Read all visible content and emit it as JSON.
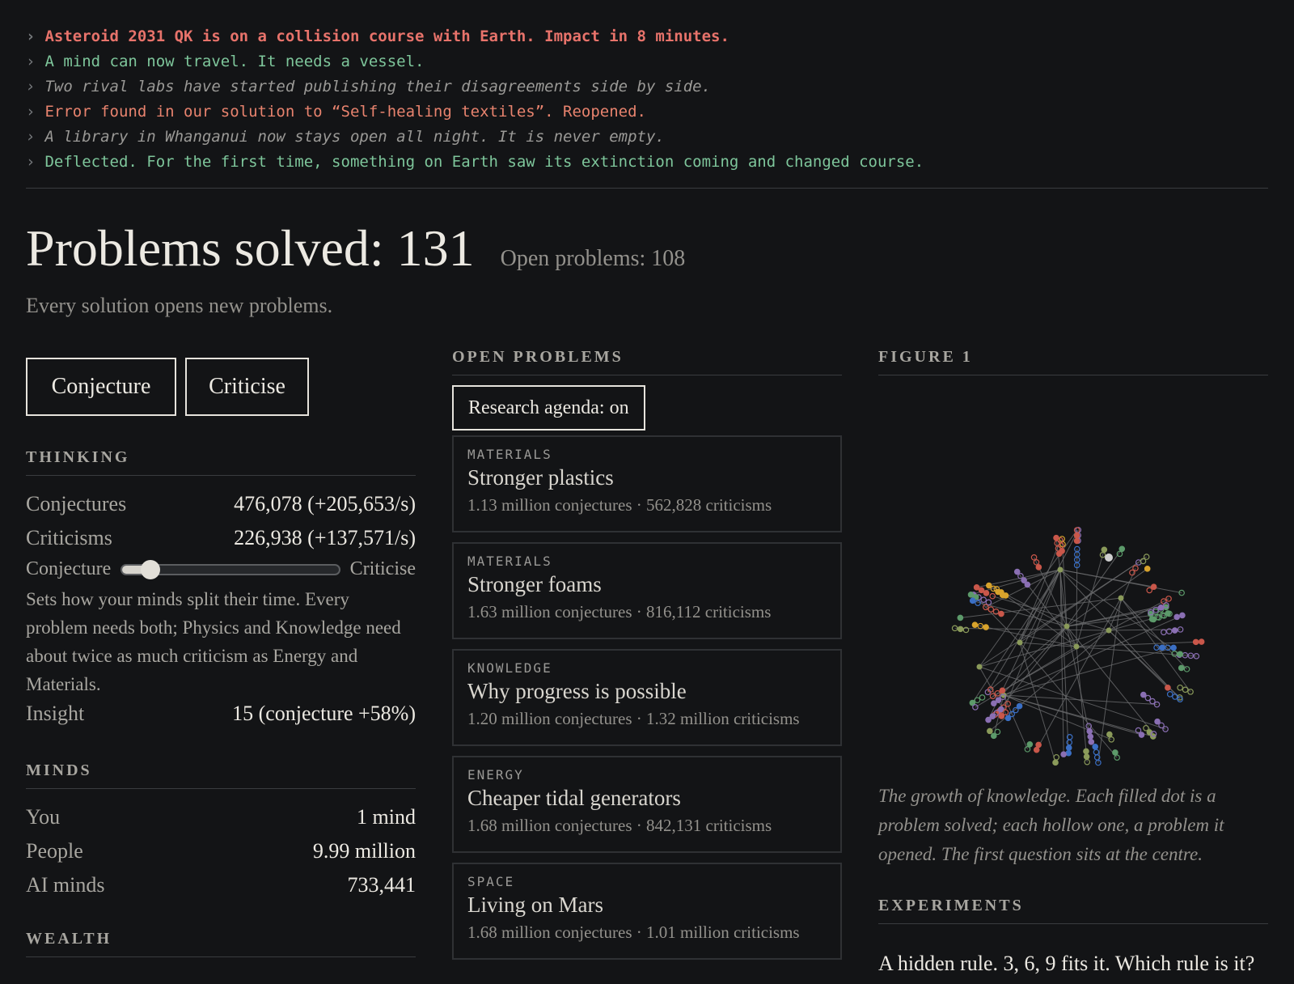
{
  "log": [
    {
      "text": "Asteroid 2031 QK is on a collision course with Earth. Impact in 8 minutes.",
      "kind": "alert"
    },
    {
      "text": "A mind can now travel. It needs a vessel.",
      "kind": "good"
    },
    {
      "text": "Two rival labs have started publishing their disagreements side by side.",
      "kind": "muted"
    },
    {
      "text": "Error found in our solution to “Self-healing textiles”. Reopened.",
      "kind": "error"
    },
    {
      "text": "A library in Whanganui now stays open all night. It is never empty.",
      "kind": "muted"
    },
    {
      "text": "Deflected. For the first time, something on Earth saw its extinction coming and changed course.",
      "kind": "good"
    }
  ],
  "log_chevron": "›",
  "header": {
    "solved": "Problems solved: 131",
    "open": "Open problems: 108",
    "tagline": "Every solution opens new problems."
  },
  "actions": {
    "conjecture": "Conjecture",
    "criticise": "Criticise"
  },
  "thinking": {
    "title": "THINKING",
    "conjectures_label": "Conjectures",
    "conjectures_value": "476,078 (+205,653/s)",
    "criticisms_label": "Criticisms",
    "criticisms_value": "226,938 (+137,571/s)",
    "slider_left": "Conjecture",
    "slider_right": "Criticise",
    "slider_value": 0.12,
    "description": "Sets how your minds split their time. Every problem needs both; Physics and Knowledge need about twice as much criticism as Energy and Materials.",
    "insight_label": "Insight",
    "insight_value": "15 (conjecture +58%)"
  },
  "minds": {
    "title": "MINDS",
    "rows": [
      {
        "label": "You",
        "value": "1 mind"
      },
      {
        "label": "People",
        "value": "9.99 million"
      },
      {
        "label": "AI minds",
        "value": "733,441"
      }
    ]
  },
  "wealth": {
    "title": "WEALTH"
  },
  "open_problems": {
    "title": "OPEN PROBLEMS",
    "agenda": "Research agenda: on",
    "items": [
      {
        "category": "MATERIALS",
        "name": "Stronger plastics",
        "meta": "1.13 million conjectures · 562,828 criticisms"
      },
      {
        "category": "MATERIALS",
        "name": "Stronger foams",
        "meta": "1.63 million conjectures · 816,112 criticisms"
      },
      {
        "category": "KNOWLEDGE",
        "name": "Why progress is possible",
        "meta": "1.20 million conjectures · 1.32 million criticisms"
      },
      {
        "category": "ENERGY",
        "name": "Cheaper tidal generators",
        "meta": "1.68 million conjectures · 842,131 criticisms"
      },
      {
        "category": "SPACE",
        "name": "Living on Mars",
        "meta": "1.68 million conjectures · 1.01 million criticisms"
      }
    ]
  },
  "figure": {
    "title": "FIGURE 1",
    "caption": "The growth of knowledge. Each filled dot is a problem solved; each hollow one, a problem it opened. The first question sits at the centre.",
    "colors": {
      "materials": "#d8a32c",
      "knowledge": "#8a9a5a",
      "energy": "#c9574a",
      "space": "#3b6fc4",
      "physics": "#5c9a6a",
      "other": "#8a6fb3",
      "root": "#cfcfcf",
      "edge": "#6a6b6d"
    }
  },
  "experiments": {
    "title": "EXPERIMENTS",
    "question": "A hidden rule. 3, 6, 9 fits it. Which rule is it?"
  }
}
